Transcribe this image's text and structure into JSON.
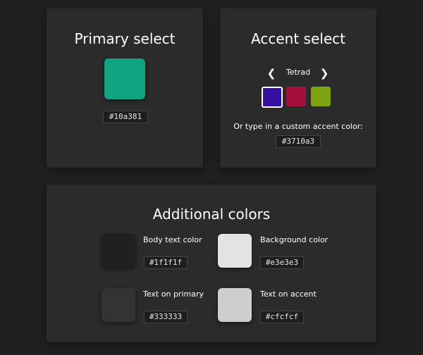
{
  "primary": {
    "title": "Primary select",
    "swatch_color": "#10a381",
    "hex_value": "#10a381"
  },
  "accent": {
    "title": "Accent select",
    "scheme_label": "Tetrad",
    "prev_icon": "chevron-left-icon",
    "next_icon": "chevron-right-icon",
    "swatches": [
      {
        "color": "#3710a3",
        "selected": true
      },
      {
        "color": "#a3103a",
        "selected": false
      },
      {
        "color": "#7ea310",
        "selected": false
      }
    ],
    "custom_label": "Or type in a custom accent color:",
    "hex_value": "#3710a3"
  },
  "additional": {
    "title": "Additional colors",
    "items": [
      {
        "label": "Body text color",
        "color": "#1f1f1f",
        "hex_value": "#1f1f1f"
      },
      {
        "label": "Background color",
        "color": "#e3e3e3",
        "hex_value": "#e3e3e3"
      },
      {
        "label": "Text on primary",
        "color": "#333333",
        "hex_value": "#333333"
      },
      {
        "label": "Text on accent",
        "color": "#cfcfcf",
        "hex_value": "#cfcfcf"
      }
    ]
  }
}
